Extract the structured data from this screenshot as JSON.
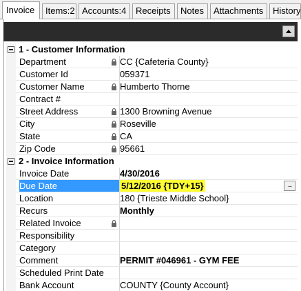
{
  "tabs": [
    {
      "label": "Invoice",
      "active": true
    },
    {
      "label": "Items:2",
      "active": false
    },
    {
      "label": "Accounts:4",
      "active": false
    },
    {
      "label": "Receipts",
      "active": false
    },
    {
      "label": "Notes",
      "active": false
    },
    {
      "label": "Attachments",
      "active": false
    },
    {
      "label": "History",
      "active": false
    }
  ],
  "sections": [
    {
      "title": "1 - Customer Information",
      "rows": [
        {
          "label": "Department",
          "value": "CC {Cafeteria County}",
          "locked": true
        },
        {
          "label": "Customer Id",
          "value": "059371",
          "locked": false
        },
        {
          "label": "Customer Name",
          "value": "Humberto Thorne",
          "locked": true
        },
        {
          "label": "Contract #",
          "value": "",
          "locked": false
        },
        {
          "label": "Street Address",
          "value": "1300 Browning Avenue",
          "locked": true
        },
        {
          "label": "City",
          "value": "Roseville",
          "locked": true
        },
        {
          "label": "State",
          "value": "CA",
          "locked": true
        },
        {
          "label": "Zip Code",
          "value": "95661",
          "locked": true
        }
      ]
    },
    {
      "title": "2 - Invoice Information",
      "rows": [
        {
          "label": "Invoice Date",
          "value": "4/30/2016",
          "bold": true
        },
        {
          "label": "Due Date",
          "value": "5/12/2016 {TDY+15}",
          "highlighted": true,
          "selected": true,
          "has_button": true
        },
        {
          "label": "Location",
          "value": "180 {Trieste Middle School}"
        },
        {
          "label": "Recurs",
          "value": "Monthly",
          "bold": true
        },
        {
          "label": "Related Invoice",
          "value": "",
          "locked": true
        },
        {
          "label": "Responsibility",
          "value": ""
        },
        {
          "label": "Category",
          "value": ""
        },
        {
          "label": "Comment",
          "value": "PERMIT #046961 - GYM FEE",
          "bold": true
        },
        {
          "label": "Scheduled Print Date",
          "value": ""
        },
        {
          "label": "Bank Account",
          "value": "COUNTY {County Account}"
        }
      ]
    }
  ],
  "ellipsis_label": "...",
  "colors": {
    "selected": "#3399ff",
    "highlight": "#ffff33",
    "header_bar": "#2b2b2b"
  }
}
